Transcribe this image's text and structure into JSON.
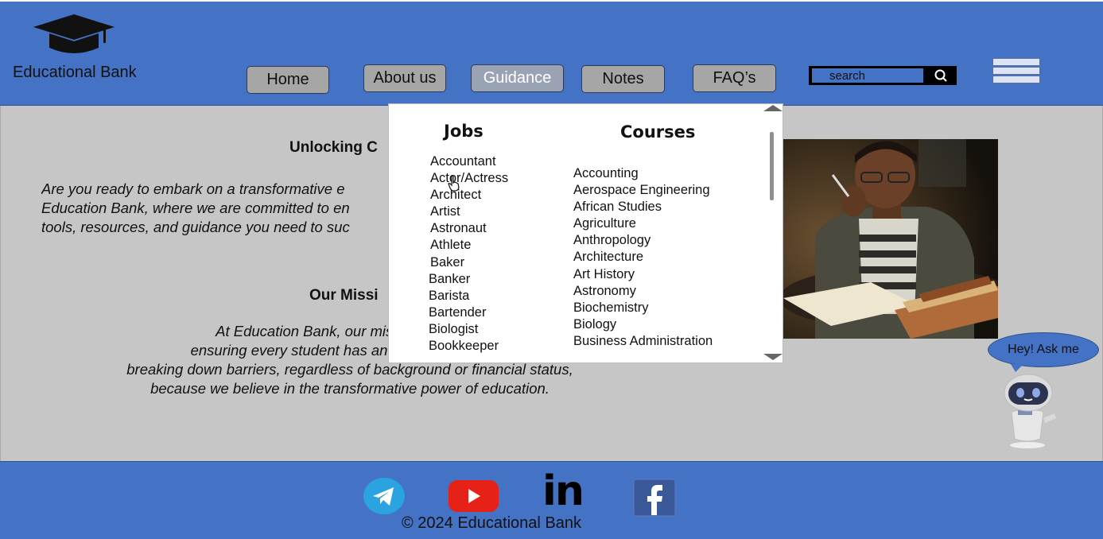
{
  "header": {
    "brand": "Educational Bank",
    "logo_icon": "graduation-cap-icon",
    "nav": [
      {
        "label": "Home"
      },
      {
        "label": "About us"
      },
      {
        "label": "Guidance",
        "active": true
      },
      {
        "label": "Notes"
      },
      {
        "label": "FAQ’s"
      }
    ],
    "search": {
      "placeholder": "search",
      "icon": "search-icon"
    },
    "menu_icon": "hamburger-menu-icon"
  },
  "main": {
    "unlock_heading": "Unlocking C",
    "intro_lines": [
      "Are you ready to embark on a transformative e",
      "Education Bank, where we are committed to en",
      "tools, resources, and guidance you need to suc"
    ],
    "mission_heading": "Our Missi",
    "mission_lines": [
      "At Education Bank, our mission is to br",
      "ensuring every student has an equal shot c",
      "breaking down barriers, regardless of background or financial status,",
      "because we believe in the transformative power of education."
    ]
  },
  "guidance_menu": {
    "jobs_title": "Jobs",
    "courses_title": "Courses",
    "jobs": [
      "Accountant",
      "Actor/Actress",
      "Architect",
      "Artist",
      "Astronaut",
      "Athlete",
      "Baker",
      "Banker",
      "Barista",
      "Bartender",
      "Biologist",
      "Bookkeeper"
    ],
    "courses": [
      "Accounting",
      "Aerospace Engineering",
      "African Studies",
      "Agriculture",
      "Anthropology",
      "Architecture",
      "Art History",
      "Astronomy",
      "Biochemistry",
      "Biology",
      "Business Administration"
    ]
  },
  "chatbot": {
    "bubble": "Hey! Ask me",
    "icon": "robot-icon"
  },
  "footer": {
    "social": [
      "telegram-icon",
      "youtube-icon",
      "linkedin-icon",
      "facebook-icon"
    ],
    "linkedin_text": "in",
    "copyright": "© 2024 Educational Bank"
  },
  "colors": {
    "header_bg": "#4472c4",
    "main_bg": "#c6c6c6",
    "button_bg": "#a6a6a6",
    "footer_bg": "#4472c4"
  }
}
